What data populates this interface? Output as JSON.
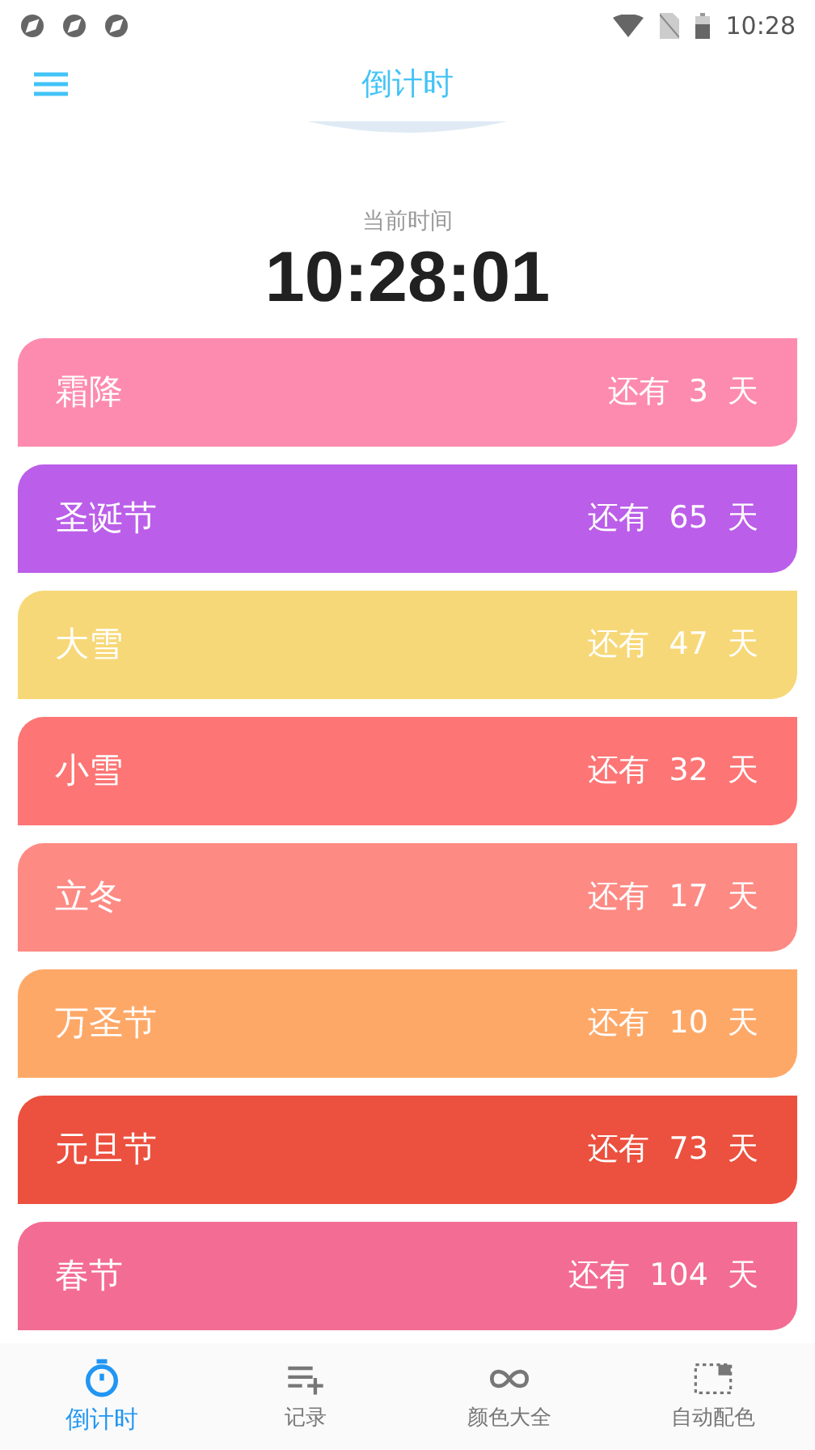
{
  "status_bar": {
    "time": "10:28"
  },
  "header": {
    "title": "倒计时"
  },
  "clock": {
    "label": "当前时间",
    "time": "10:28:01"
  },
  "events": [
    {
      "name": "霜降",
      "countdown": "还有  3  天",
      "color": "#fd8bb0"
    },
    {
      "name": "圣诞节",
      "countdown": "还有  65  天",
      "color": "#bb5ee9"
    },
    {
      "name": "大雪",
      "countdown": "还有  47  天",
      "color": "#f7d878"
    },
    {
      "name": "小雪",
      "countdown": "还有  32  天",
      "color": "#fd7575"
    },
    {
      "name": "立冬",
      "countdown": "还有  17  天",
      "color": "#fe8a84"
    },
    {
      "name": "万圣节",
      "countdown": "还有  10  天",
      "color": "#fea868"
    },
    {
      "name": "元旦节",
      "countdown": "还有  73  天",
      "color": "#ec503e"
    },
    {
      "name": "春节",
      "countdown": "还有  104  天",
      "color": "#f36c93"
    }
  ],
  "bottom_nav": [
    {
      "label": "倒计时",
      "kind": "timer",
      "selected": true
    },
    {
      "label": "记录",
      "kind": "record",
      "selected": false
    },
    {
      "label": "颜色大全",
      "kind": "colors",
      "selected": false
    },
    {
      "label": "自动配色",
      "kind": "auto",
      "selected": false
    }
  ]
}
